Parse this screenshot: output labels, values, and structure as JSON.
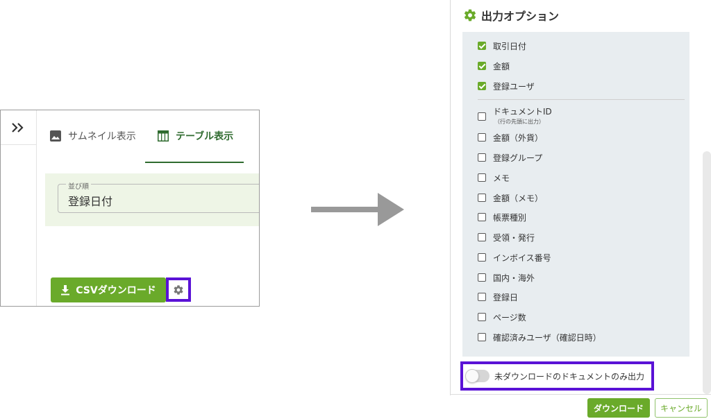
{
  "left": {
    "tabs": [
      {
        "label": "サムネイル表示",
        "icon": "image-icon"
      },
      {
        "label": "テーブル表示",
        "icon": "table-icon"
      }
    ],
    "sort": {
      "label": "並び順",
      "value": "登録日付"
    },
    "csv_button": "CSVダウンロード"
  },
  "options": {
    "title": "出力オプション",
    "checked": [
      "取引日付",
      "金額",
      "登録ユーザ"
    ],
    "unchecked": [
      "ドキュメントID",
      "金額（外貨）",
      "登録グループ",
      "メモ",
      "金額（メモ）",
      "帳票種別",
      "受領・発行",
      "インボイス番号",
      "国内・海外",
      "登録日",
      "ページ数",
      "確認済みユーザ（確認日時）"
    ],
    "doc_id_note": "（行の先頭に出力）",
    "toggle_label": "未ダウンロードのドキュメントのみ出力",
    "download_button": "ダウンロード",
    "cancel_button": "キャンセル"
  },
  "colors": {
    "accent": "#6aaa2a",
    "dark_green": "#2f6b2f",
    "highlight": "#5a12d6"
  }
}
